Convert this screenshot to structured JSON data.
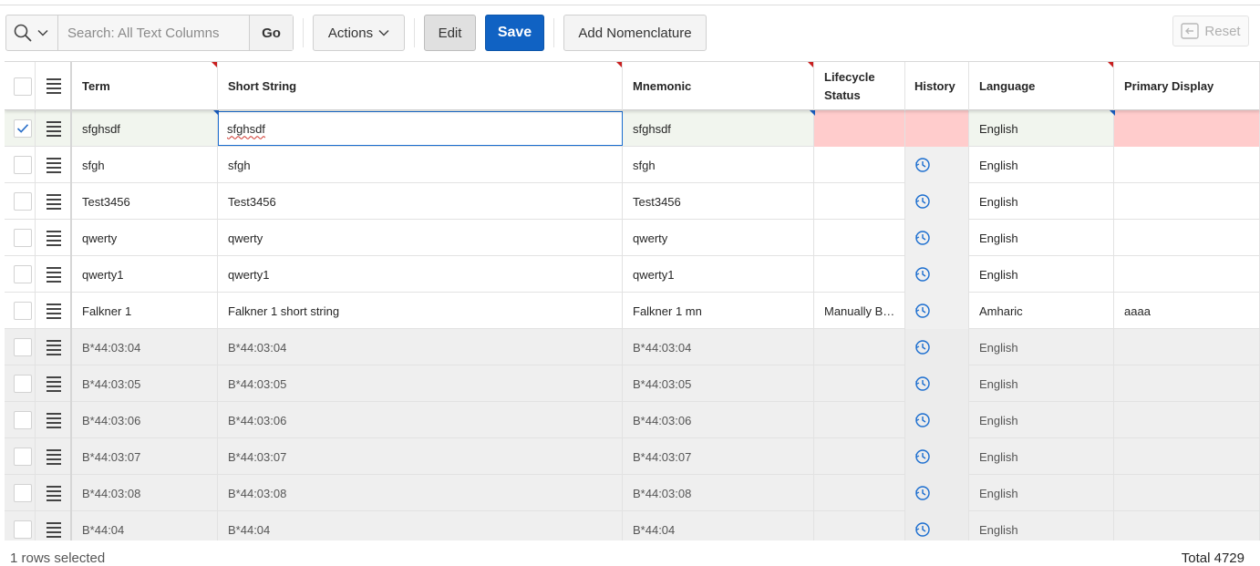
{
  "toolbar": {
    "search_placeholder": "Search: All Text Columns",
    "go_label": "Go",
    "actions_label": "Actions",
    "edit_label": "Edit",
    "save_label": "Save",
    "add_nomenclature_label": "Add Nomenclature",
    "reset_label": "Reset"
  },
  "columns": {
    "term": "Term",
    "short_string": "Short String",
    "mnemonic": "Mnemonic",
    "lifecycle_line1": "Lifecycle",
    "lifecycle_line2": "Status",
    "history": "History",
    "language": "Language",
    "primary_display": "Primary Display"
  },
  "rows": [
    {
      "term": "sfghsdf",
      "short": "sfghsdf",
      "mnemonic": "sfghsdf",
      "lifecycle": "",
      "language": "English",
      "primary": "",
      "selected": true
    },
    {
      "term": "sfgh",
      "short": "sfgh",
      "mnemonic": "sfgh",
      "lifecycle": "",
      "language": "English",
      "primary": ""
    },
    {
      "term": "Test3456",
      "short": "Test3456",
      "mnemonic": "Test3456",
      "lifecycle": "",
      "language": "English",
      "primary": ""
    },
    {
      "term": "qwerty",
      "short": "qwerty",
      "mnemonic": "qwerty",
      "lifecycle": "",
      "language": "English",
      "primary": ""
    },
    {
      "term": "qwerty1",
      "short": "qwerty1",
      "mnemonic": "qwerty1",
      "lifecycle": "",
      "language": "English",
      "primary": ""
    },
    {
      "term": "Falkner 1",
      "short": "Falkner 1 short string",
      "mnemonic": "Falkner 1 mn",
      "lifecycle": "Manually B…",
      "language": "Amharic",
      "primary": "aaaa"
    },
    {
      "term": "B*44:03:04",
      "short": "B*44:03:04",
      "mnemonic": "B*44:03:04",
      "lifecycle": "",
      "language": "English",
      "primary": "",
      "readonly": true
    },
    {
      "term": "B*44:03:05",
      "short": "B*44:03:05",
      "mnemonic": "B*44:03:05",
      "lifecycle": "",
      "language": "English",
      "primary": "",
      "readonly": true
    },
    {
      "term": "B*44:03:06",
      "short": "B*44:03:06",
      "mnemonic": "B*44:03:06",
      "lifecycle": "",
      "language": "English",
      "primary": "",
      "readonly": true
    },
    {
      "term": "B*44:03:07",
      "short": "B*44:03:07",
      "mnemonic": "B*44:03:07",
      "lifecycle": "",
      "language": "English",
      "primary": "",
      "readonly": true
    },
    {
      "term": "B*44:03:08",
      "short": "B*44:03:08",
      "mnemonic": "B*44:03:08",
      "lifecycle": "",
      "language": "English",
      "primary": "",
      "readonly": true
    },
    {
      "term": "B*44:04",
      "short": "B*44:04",
      "mnemonic": "B*44:04",
      "lifecycle": "",
      "language": "English",
      "primary": "",
      "readonly": true
    }
  ],
  "footer": {
    "selected_text": "1 rows selected",
    "total_text": "Total 4729"
  },
  "colors": {
    "primary_button": "#1062c3",
    "error_cell": "#ffcccc",
    "selected_row": "#f1f5ee",
    "readonly_row": "#efefef",
    "history_icon": "#1a6dcf"
  },
  "icons": {
    "search": "search-icon",
    "chevron": "chevron-down-icon",
    "row_menu": "row-actions-menu-icon",
    "history": "history-clock-icon",
    "reset": "reset-icon",
    "check": "checkmark-icon"
  }
}
